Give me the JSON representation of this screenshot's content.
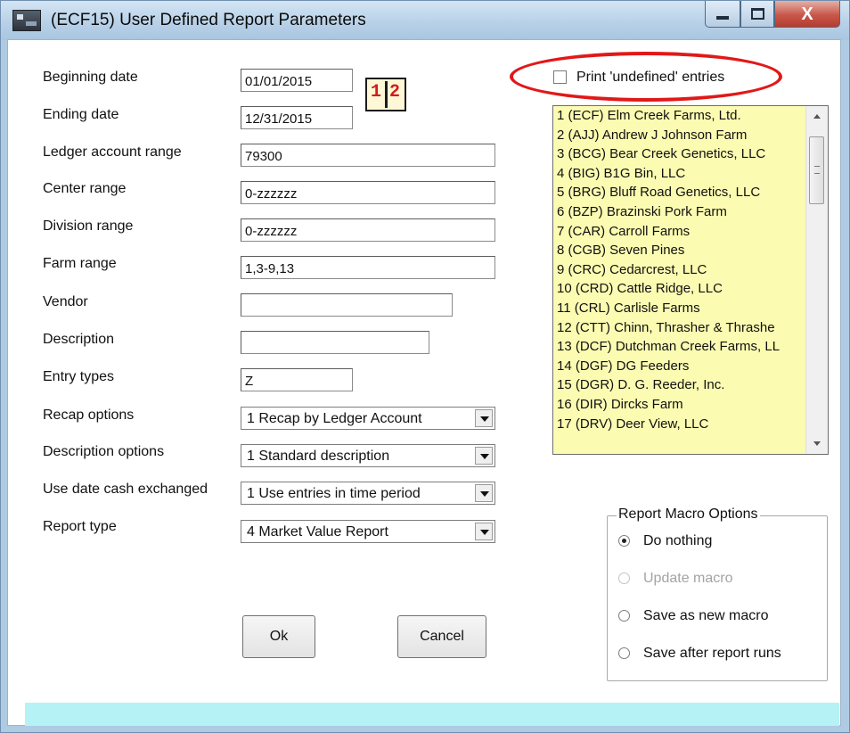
{
  "window": {
    "title": "(ECF15)  User Defined Report Parameters",
    "close_glyph": "X"
  },
  "form": {
    "beginning_date": {
      "label": "Beginning date",
      "value": "01/01/2015"
    },
    "ending_date": {
      "label": "Ending date",
      "value": "12/31/2015"
    },
    "ledger_account_range": {
      "label": "Ledger account range",
      "value": "79300"
    },
    "center_range": {
      "label": "Center range",
      "value": "0-zzzzzz"
    },
    "division_range": {
      "label": "Division range",
      "value": "0-zzzzzz"
    },
    "farm_range": {
      "label": "Farm range",
      "value": "1,3-9,13"
    },
    "vendor": {
      "label": "Vendor",
      "value": ""
    },
    "description": {
      "label": "Description",
      "value": ""
    },
    "entry_types": {
      "label": "Entry types",
      "value": "Z"
    },
    "recap_options": {
      "label": "Recap options",
      "value": "1  Recap by Ledger Account"
    },
    "description_options": {
      "label": "Description options",
      "value": "1  Standard description"
    },
    "use_date_cash_exchanged": {
      "label": "Use date cash exchanged",
      "value": "1  Use entries in time period"
    },
    "report_type": {
      "label": "Report type",
      "value": "4  Market Value Report"
    }
  },
  "print_undefined": {
    "label": "Print 'undefined' entries",
    "checked": false
  },
  "farm_list": [
    "1  (ECF)  Elm Creek Farms, Ltd.",
    "2  (AJJ)  Andrew J Johnson Farm",
    "3  (BCG)  Bear Creek Genetics, LLC",
    "4  (BIG)  B1G Bin, LLC",
    "5  (BRG)  Bluff Road Genetics, LLC",
    "6  (BZP)  Brazinski Pork Farm",
    "7  (CAR)  Carroll Farms",
    "8  (CGB)  Seven Pines",
    "9  (CRC)  Cedarcrest, LLC",
    "10  (CRD)  Cattle Ridge, LLC",
    "11  (CRL)  Carlisle Farms",
    "12  (CTT)  Chinn, Thrasher & Thrashe",
    "13  (DCF)  Dutchman Creek Farms, LL",
    "14  (DGF)  DG Feeders",
    "15  (DGR)  D. G. Reeder, Inc.",
    "16  (DIR)  Dircks Farm",
    "17  (DRV)  Deer View, LLC"
  ],
  "macro_options": {
    "title": "Report Macro Options",
    "options": [
      {
        "label": "Do nothing",
        "selected": true,
        "enabled": true
      },
      {
        "label": "Update macro",
        "selected": false,
        "enabled": false
      },
      {
        "label": "Save as new macro",
        "selected": false,
        "enabled": true
      },
      {
        "label": "Save after report  runs",
        "selected": false,
        "enabled": true
      }
    ]
  },
  "buttons": {
    "ok": "Ok",
    "cancel": "Cancel"
  },
  "colors": {
    "list_background": "#fbfbb2",
    "highlight_ring": "#e21818",
    "footer_strip": "#b5f2f6",
    "close_button": "#c8574a"
  }
}
